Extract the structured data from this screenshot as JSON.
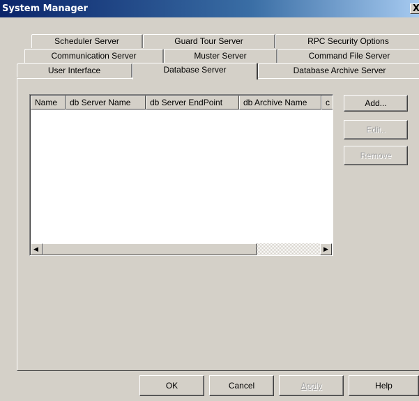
{
  "window": {
    "title": "System Manager",
    "close_glyph": "X"
  },
  "tabs": {
    "row1": [
      "Scheduler Server",
      "Guard Tour Server",
      "RPC Security Options"
    ],
    "row2": [
      "Communication Server",
      "Muster Server",
      "Command File Server"
    ],
    "row3": [
      "User Interface",
      "Database Server",
      "Database Archive Server"
    ],
    "active": "Database Server"
  },
  "listview": {
    "columns": [
      "Name",
      "db Server Name",
      "db Server EndPoint",
      "db Archive Name",
      "c"
    ],
    "rows": []
  },
  "side_buttons": {
    "add": "Add...",
    "edit": "Edit..",
    "remove": "Remove"
  },
  "footer_buttons": {
    "ok": "OK",
    "cancel": "Cancel",
    "apply": "Apply",
    "help": "Help"
  },
  "icons": {
    "close": "close-icon",
    "scroll_left": "arrow-left-icon",
    "scroll_right": "arrow-right-icon"
  }
}
